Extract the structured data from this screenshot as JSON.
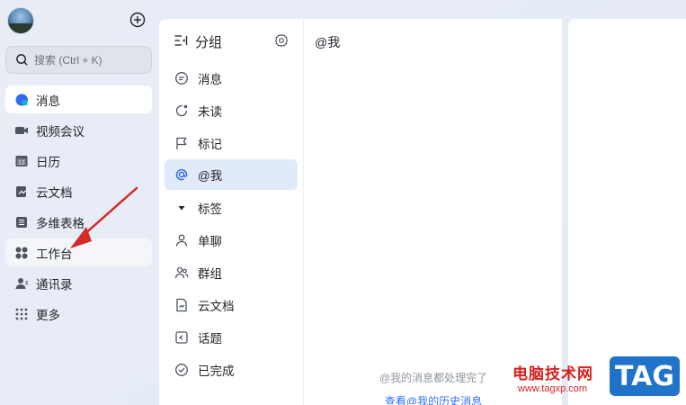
{
  "leftnav": {
    "search_placeholder": "搜索 (Ctrl + K)",
    "items": [
      {
        "label": "消息",
        "icon": "chat-bubble-icon",
        "active": true
      },
      {
        "label": "视频会议",
        "icon": "video-camera-icon"
      },
      {
        "label": "日历",
        "icon": "calendar-icon"
      },
      {
        "label": "云文档",
        "icon": "cloud-doc-icon"
      },
      {
        "label": "多维表格",
        "icon": "table-icon"
      },
      {
        "label": "工作台",
        "icon": "apps-grid-icon"
      },
      {
        "label": "通讯录",
        "icon": "contacts-icon"
      },
      {
        "label": "更多",
        "icon": "more-dots-icon"
      }
    ]
  },
  "groups": {
    "title": "分组",
    "items": [
      {
        "label": "消息",
        "icon": "message-icon"
      },
      {
        "label": "未读",
        "icon": "unread-icon"
      },
      {
        "label": "标记",
        "icon": "flag-icon"
      },
      {
        "label": "@我",
        "icon": "at-icon",
        "active": true
      },
      {
        "label": "标签",
        "icon": "triangle-down-icon"
      },
      {
        "label": "单聊",
        "icon": "person-icon"
      },
      {
        "label": "群组",
        "icon": "group-icon"
      },
      {
        "label": "云文档",
        "icon": "document-icon"
      },
      {
        "label": "话题",
        "icon": "topic-icon"
      },
      {
        "label": "已完成",
        "icon": "check-circle-icon"
      }
    ]
  },
  "main": {
    "title": "@我",
    "empty_text": "@我的消息都处理完了",
    "history_link": "查看@我的历史消息"
  },
  "watermark": {
    "text": "电脑技术网",
    "url": "www.tagxp.com",
    "tag": "TAG"
  },
  "colors": {
    "accent": "#3370ff",
    "active_group_bg": "#e1eaf8",
    "arrow": "#d42a2a",
    "watermark_red": "#d8201e",
    "tag_blue": "#1f74c9"
  }
}
